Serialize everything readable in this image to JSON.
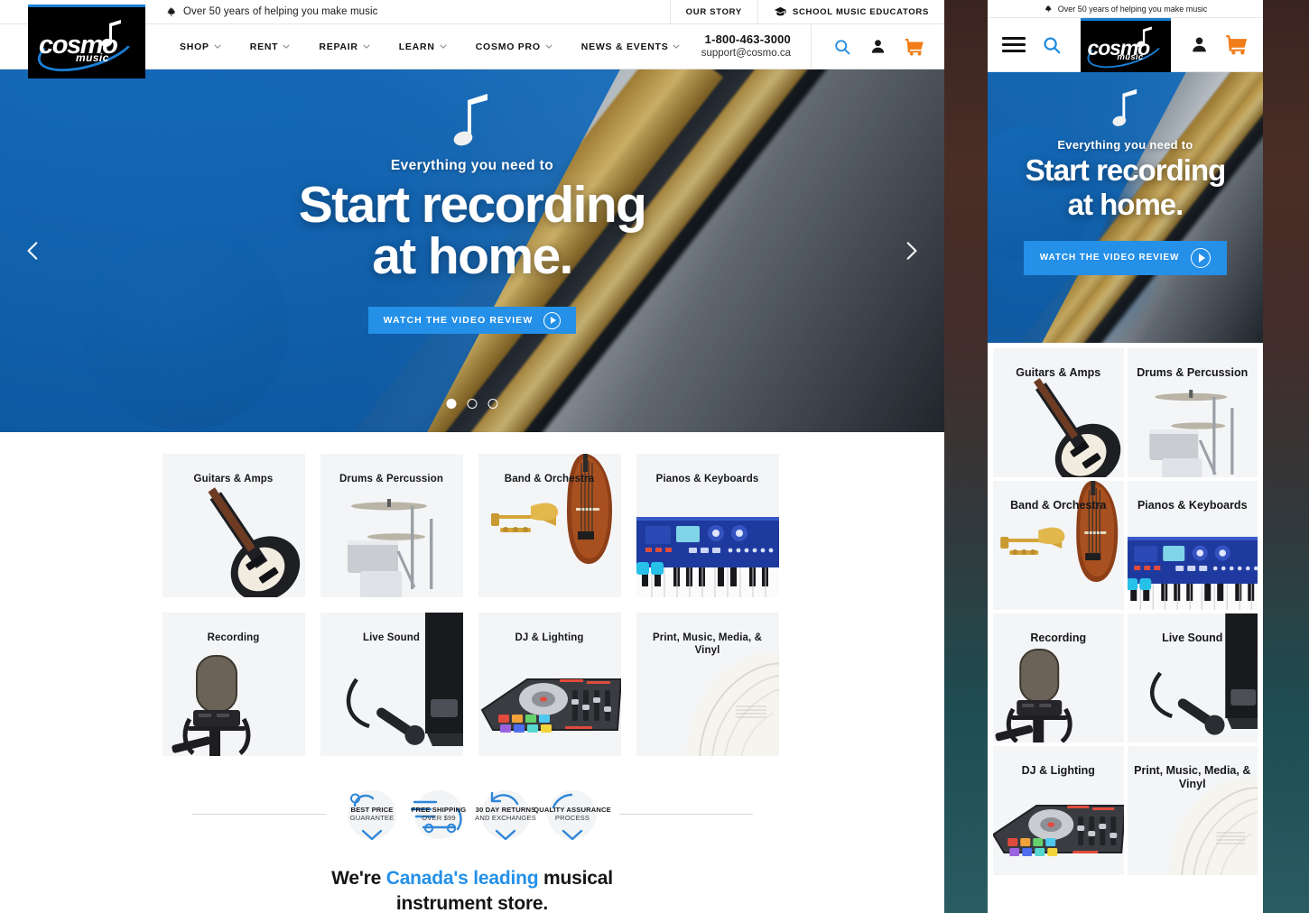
{
  "brand": {
    "logo_word": "cosmo",
    "logo_sub": "music"
  },
  "utility_bar": {
    "maple_icon": "maple-leaf-icon",
    "tagline": "Over 50 years of helping you make music",
    "links": [
      {
        "label": "OUR STORY",
        "icon": null
      },
      {
        "label": "SCHOOL MUSIC EDUCATORS",
        "icon": "graduation-cap-icon"
      }
    ]
  },
  "nav": {
    "items": [
      {
        "label": "SHOP",
        "has_dropdown": true
      },
      {
        "label": "RENT",
        "has_dropdown": true
      },
      {
        "label": "REPAIR",
        "has_dropdown": true
      },
      {
        "label": "LEARN",
        "has_dropdown": true
      },
      {
        "label": "COSMO PRO",
        "has_dropdown": true
      },
      {
        "label": "NEWS & EVENTS",
        "has_dropdown": true
      }
    ],
    "phone": "1-800-463-3000",
    "email": "support@cosmo.ca",
    "icons": [
      "search-icon",
      "account-icon",
      "cart-icon"
    ]
  },
  "hero": {
    "kicker": "Everything you need to",
    "title_line1": "Start recording",
    "title_line2": "at home.",
    "button_label": "WATCH THE VIDEO REVIEW",
    "button_icon": "play-icon",
    "prev_icon": "chevron-left-icon",
    "next_icon": "chevron-right-icon",
    "slide_count": 3,
    "active_slide": 1,
    "accent_color": "#2490e8"
  },
  "categories": [
    {
      "label": "Guitars & Amps",
      "art": "guitar"
    },
    {
      "label": "Drums & Percussion",
      "art": "drums"
    },
    {
      "label": "Band & Orchestra",
      "art": "orchestra"
    },
    {
      "label": "Pianos & Keyboards",
      "art": "keyboard"
    },
    {
      "label": "Recording",
      "art": "mic"
    },
    {
      "label": "Live Sound",
      "art": "livesound"
    },
    {
      "label": "DJ & Lighting",
      "art": "dj"
    },
    {
      "label": "Print, Music, Media, & Vinyl",
      "art": "print"
    }
  ],
  "badges": [
    {
      "line1": "BEST PRICE",
      "line2": "GUARANTEE",
      "icon": "price-tag-badge-icon"
    },
    {
      "line1": "FREE SHIPPING",
      "line2": "OVER $99",
      "icon": "delivery-truck-badge-icon"
    },
    {
      "line1": "30 DAY RETURNS",
      "line2": "AND EXCHANGES",
      "icon": "return-arrow-badge-icon"
    },
    {
      "line1": "QUALITY ASSURANCE",
      "line2": "PROCESS",
      "icon": "quality-check-badge-icon"
    }
  ],
  "closing": {
    "part1": "We're ",
    "highlight": "Canada's leading",
    "part2": " musical",
    "line2": "instrument store.",
    "highlight_color": "#2490e8"
  },
  "mobile": {
    "menu_icon": "hamburger-menu-icon",
    "search_icon": "search-icon",
    "account_icon": "account-icon",
    "cart_icon": "cart-icon"
  }
}
